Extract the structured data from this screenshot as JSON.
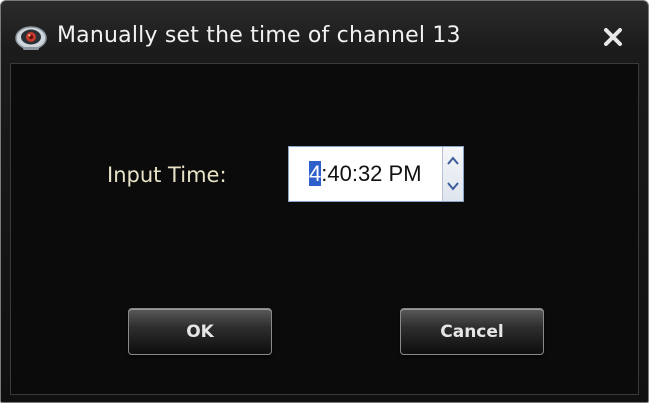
{
  "dialog": {
    "title": "Manually set the time of channel 13",
    "app_icon": "webcam-icon",
    "close_icon": "close-icon"
  },
  "form": {
    "label": "Input Time:",
    "time": {
      "hour": "4",
      "rest": ":40:32 PM",
      "up_icon": "chevron-up-icon",
      "down_icon": "chevron-down-icon"
    }
  },
  "buttons": {
    "ok_label": "OK",
    "cancel_label": "Cancel"
  },
  "colors": {
    "window_bg": "#101010",
    "label_text": "#e8e2c6",
    "selection": "#2f5fcb"
  }
}
